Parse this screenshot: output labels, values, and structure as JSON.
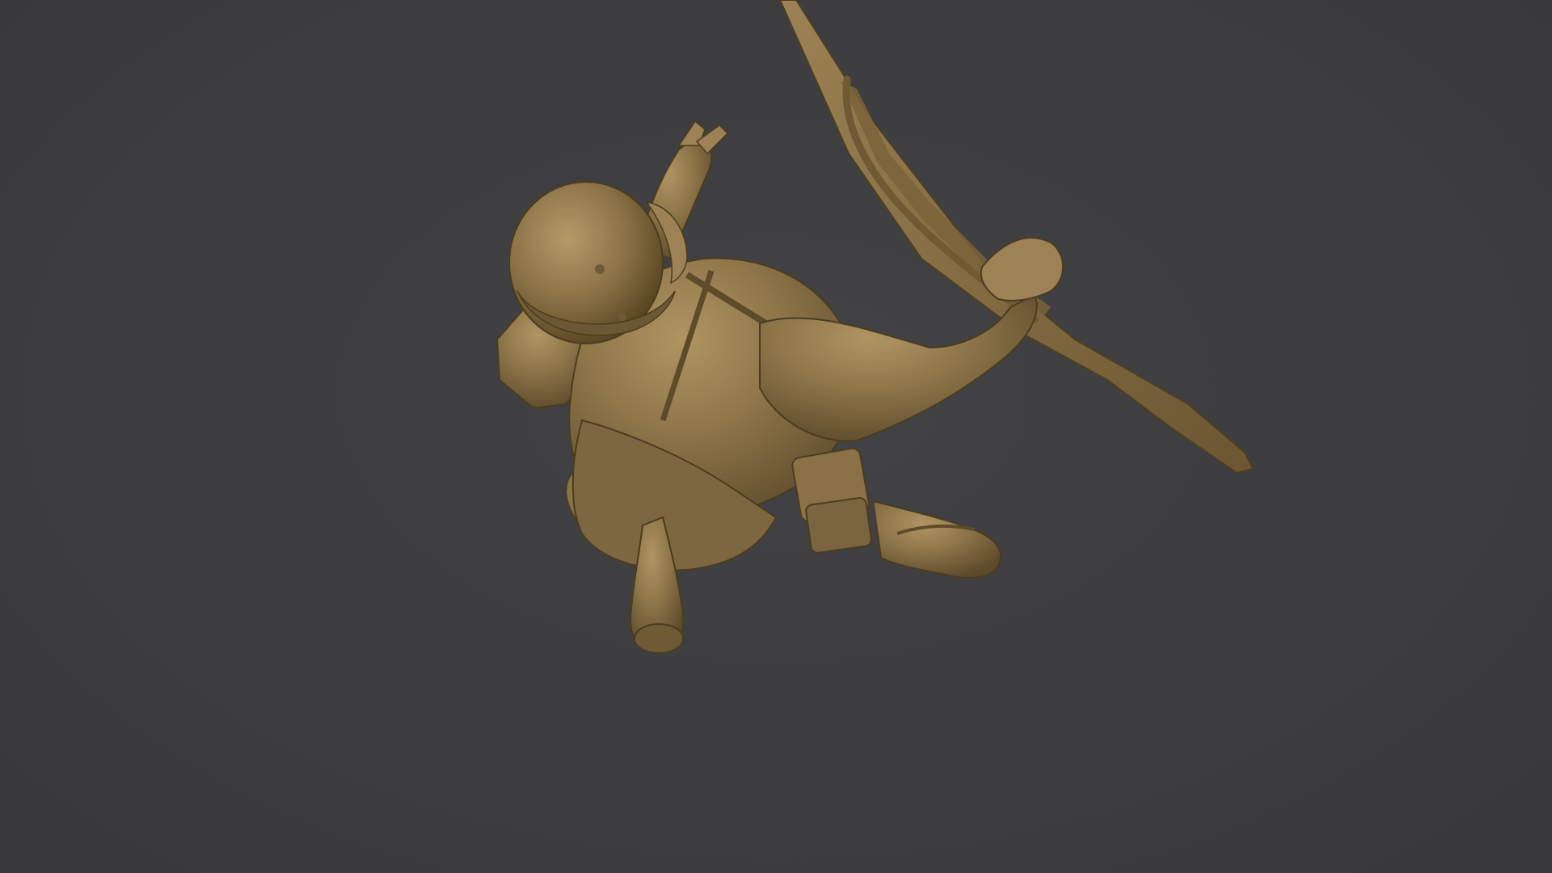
{
  "viewport": {
    "background_color": "#3d3d3f",
    "subject": "soldier-figure-sculpt",
    "material_color": "#8a7448"
  }
}
